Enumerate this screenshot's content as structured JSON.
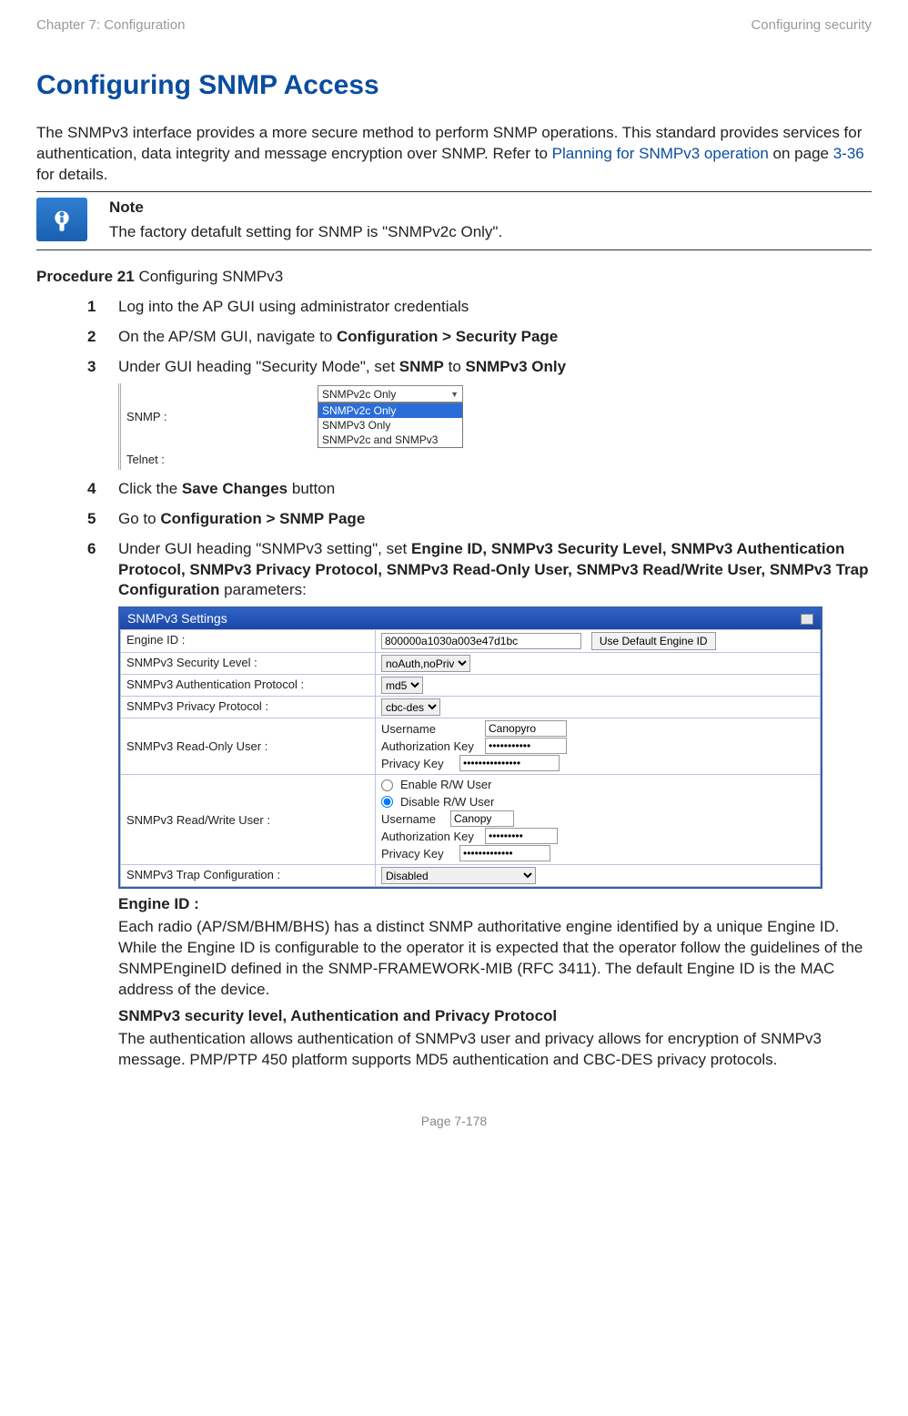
{
  "header": {
    "left": "Chapter 7:  Configuration",
    "right": "Configuring security"
  },
  "h1": "Configuring SNMP Access",
  "intro": {
    "pre": "The SNMPv3 interface provides a more secure method to perform SNMP operations. This standard provides services for authentication, data integrity and message encryption over SNMP. Refer to ",
    "link": "Planning for SNMPv3 operation",
    "mid": " on page ",
    "page": "3-36",
    "post": " for details."
  },
  "note": {
    "title": "Note",
    "body": "The factory detafult setting for SNMP is \"SNMPv2c Only\"."
  },
  "proc": {
    "label": "Procedure 21",
    "title": " Configuring SNMPv3"
  },
  "steps": {
    "s1": "Log into the AP GUI using administrator credentials",
    "s2_a": "On the AP/SM GUI, navigate to ",
    "s2_b": "Configuration > Security Page",
    "s3_a": "Under GUI heading \"Security Mode\", set ",
    "s3_b": "SNMP",
    "s3_c": " to ",
    "s3_d": "SNMPv3 Only",
    "s4_a": "Click the ",
    "s4_b": "Save Changes",
    "s4_c": " button",
    "s5_a": "Go to ",
    "s5_b": "Configuration > SNMP Page",
    "s6_a": "Under GUI heading \"SNMPv3 setting\", set ",
    "s6_b": "Engine ID, SNMPv3 Security Level, SNMPv3 Authentication Protocol, SNMPv3 Privacy Protocol, SNMPv3 Read-Only User, SNMPv3 Read/Write User, SNMPv3 Trap Configuration",
    "s6_c": " parameters:"
  },
  "shot1": {
    "snmp_label": "SNMP :",
    "telnet_label": "Telnet :",
    "selected": "SNMPv2c Only",
    "options": [
      "SNMPv2c Only",
      "SNMPv3 Only",
      "SNMPv2c and SNMPv3"
    ]
  },
  "panel": {
    "title": "SNMPv3 Settings",
    "rows": {
      "engine_id": {
        "label": "Engine ID :",
        "value": "800000a1030a003e47d1bc",
        "button": "Use Default Engine ID"
      },
      "sec_level": {
        "label": "SNMPv3 Security Level :",
        "value": "noAuth,noPriv"
      },
      "auth_proto": {
        "label": "SNMPv3 Authentication Protocol :",
        "value": "md5"
      },
      "priv_proto": {
        "label": "SNMPv3 Privacy Protocol :",
        "value": "cbc-des"
      },
      "ro_user": {
        "label": "SNMPv3 Read-Only User :",
        "user_lab": "Username",
        "user_val": "Canopyro",
        "auth_lab": "Authorization Key",
        "auth_val": "•••••••••••",
        "priv_lab": "Privacy Key",
        "priv_val": "•••••••••••••••"
      },
      "rw_user": {
        "label": "SNMPv3 Read/Write User :",
        "enable": "Enable R/W User",
        "disable": "Disable R/W User",
        "user_lab": "Username",
        "user_val": "Canopy",
        "auth_lab": "Authorization Key",
        "auth_val": "•••••••••",
        "priv_lab": "Privacy Key",
        "priv_val": "•••••••••••••"
      },
      "trap": {
        "label": "SNMPv3 Trap Configuration :",
        "value": "Disabled"
      }
    }
  },
  "post": {
    "h1": "Engine ID :",
    "p1": "Each radio (AP/SM/BHM/BHS) has a distinct SNMP authoritative engine identified by a unique Engine ID. While the Engine ID is configurable to the operator it is expected that the operator follow the guidelines of the SNMPEngineID defined in the SNMP-FRAMEWORK-MIB (RFC 3411). The default Engine ID is the MAC address of the device.",
    "h2": "SNMPv3 security level, Authentication and Privacy Protocol",
    "p2": "The authentication allows authentication of SNMPv3 user and privacy allows for encryption of SNMPv3 message. PMP/PTP 450 platform supports MD5 authentication and CBC-DES privacy protocols."
  },
  "footer": "Page 7-178"
}
